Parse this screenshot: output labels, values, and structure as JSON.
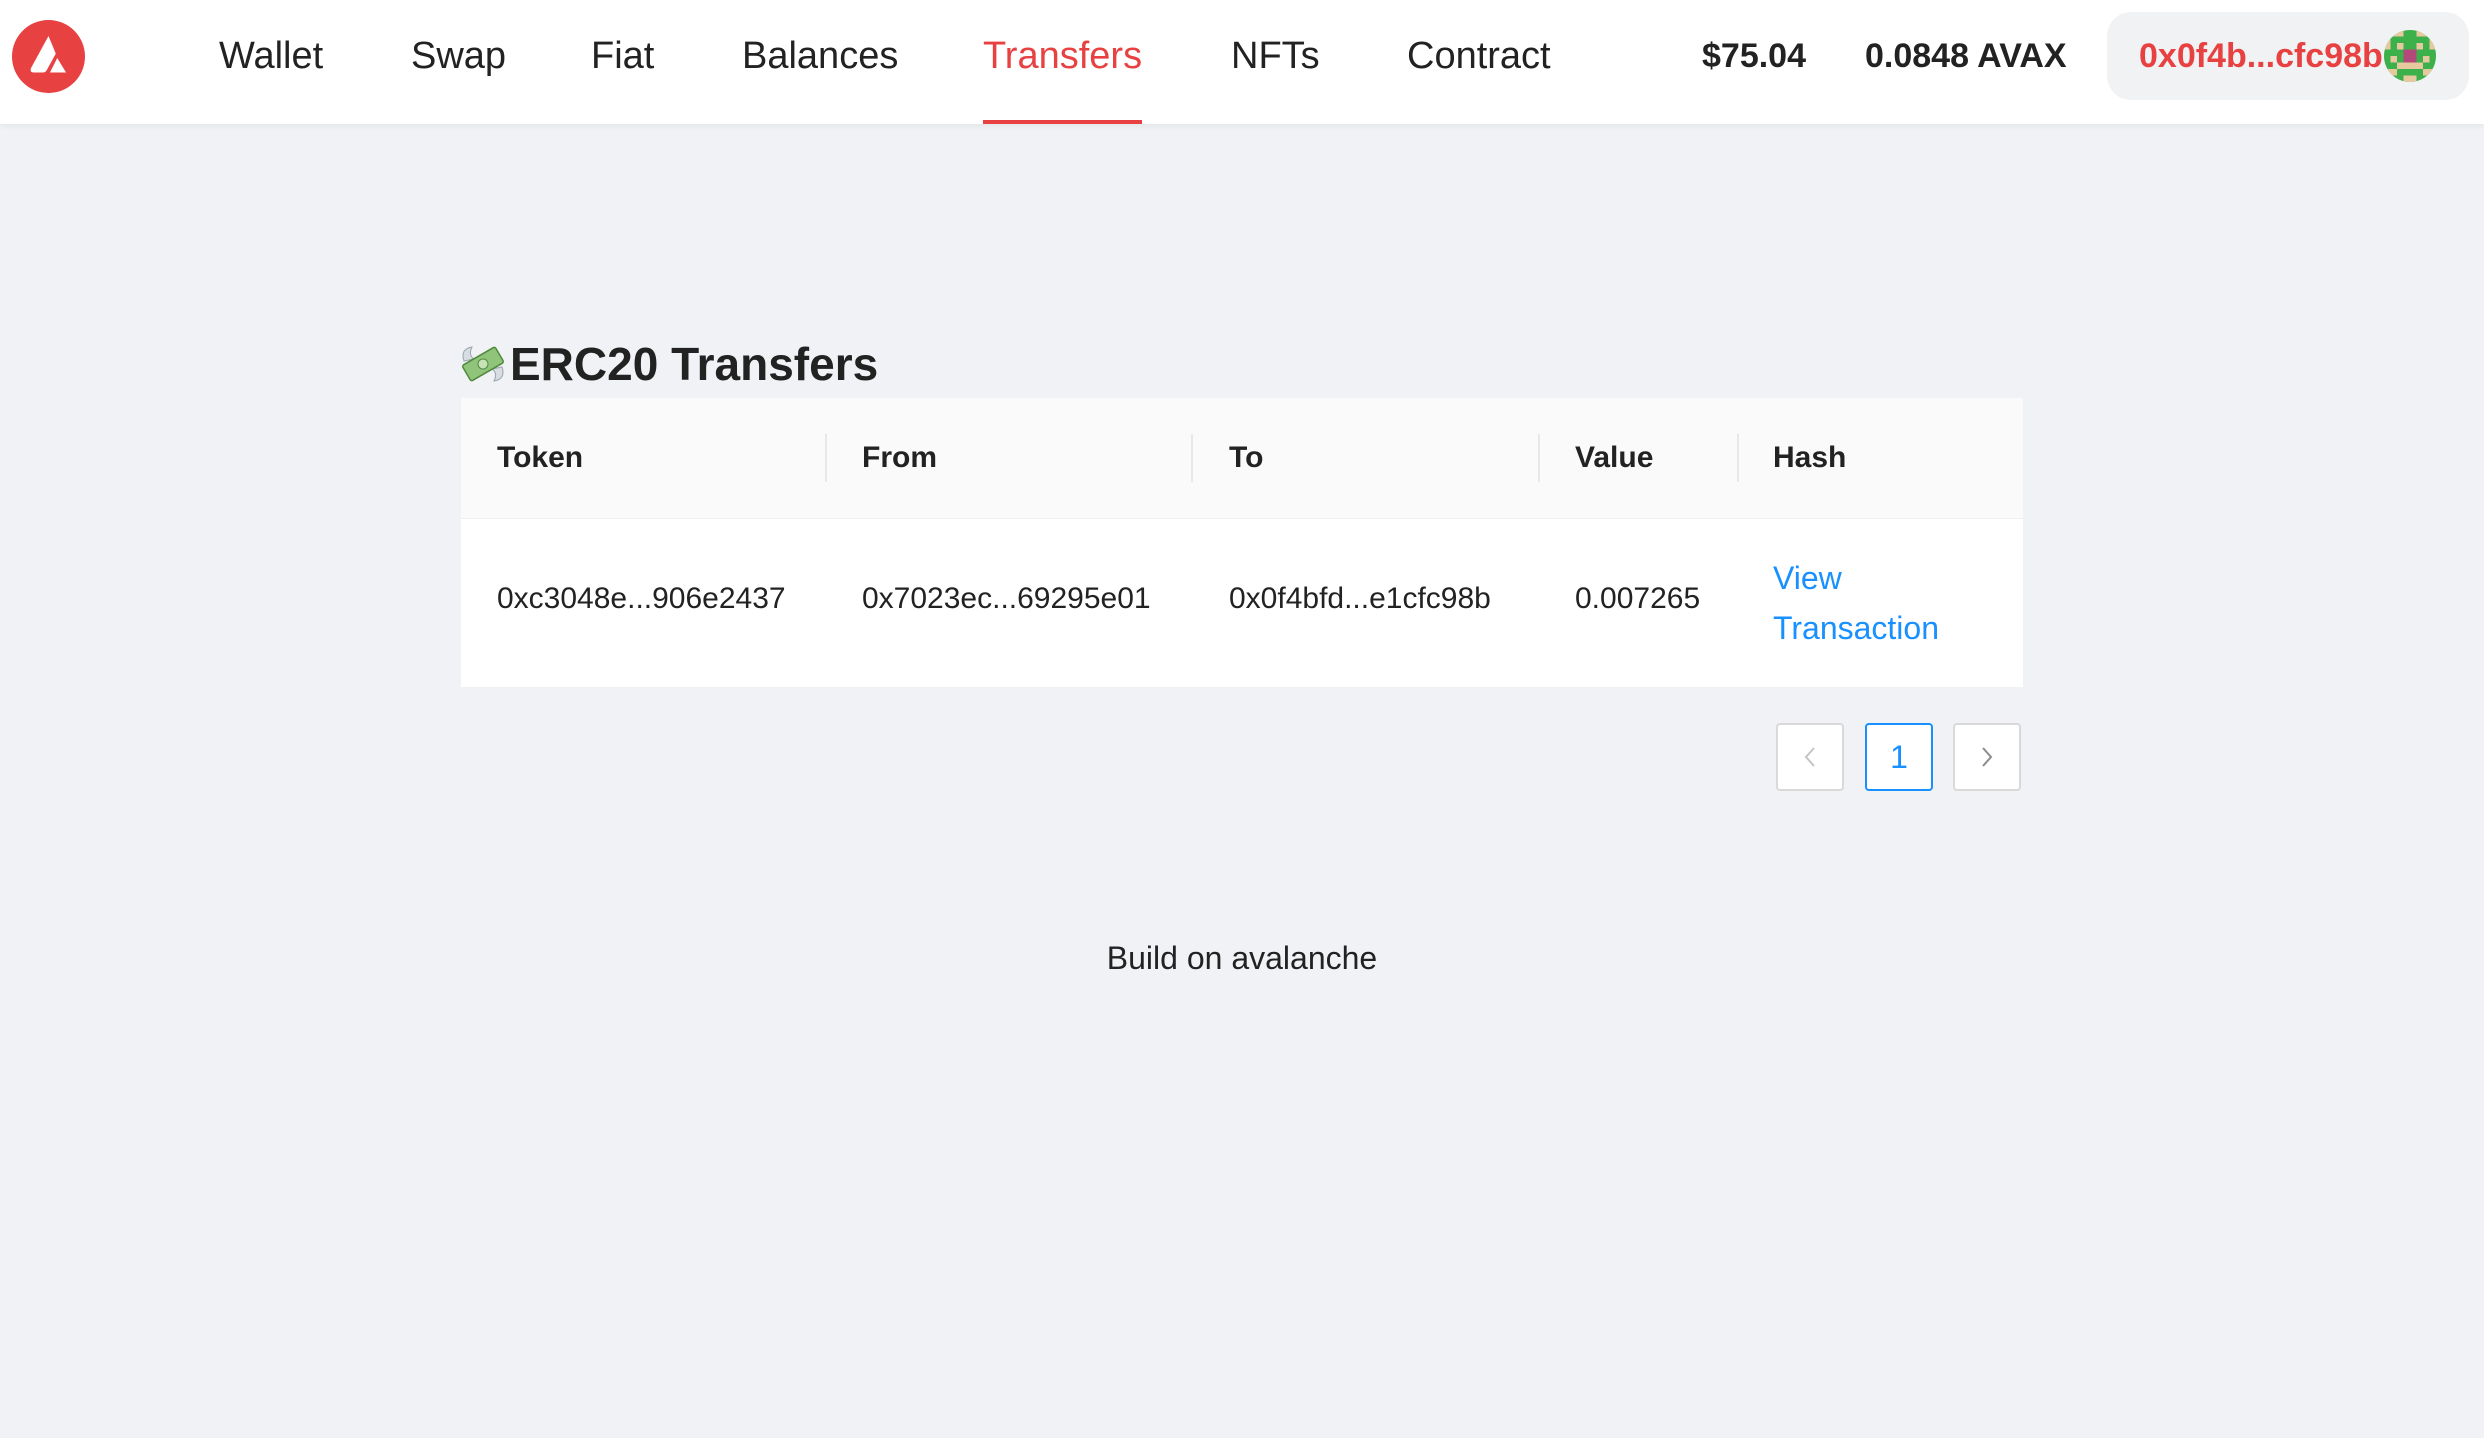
{
  "header": {
    "logo_icon": "avalanche-logo-icon",
    "nav": [
      {
        "label": "Wallet"
      },
      {
        "label": "Swap"
      },
      {
        "label": "Fiat"
      },
      {
        "label": "Balances"
      },
      {
        "label": "Transfers",
        "active": true
      },
      {
        "label": "NFTs"
      },
      {
        "label": "Contract"
      }
    ],
    "usd_balance": "$75.04",
    "avax_balance": "0.0848 AVAX",
    "account_address": "0x0f4b...cfc98b",
    "avatar_icon": "identicon-avatar"
  },
  "colors": {
    "accent": "#e84142",
    "link": "#1890ff",
    "background": "#f0f2f5"
  },
  "section": {
    "icon": "money-with-wings-icon",
    "title": "ERC20 Transfers"
  },
  "table": {
    "columns": [
      "Token",
      "From",
      "To",
      "Value",
      "Hash"
    ],
    "rows": [
      {
        "token": "0xc3048e...906e2437",
        "from": "0x7023ec...69295e01",
        "to": "0x0f4bfd...e1cfc98b",
        "value": "0.007265",
        "hash_link_line1": "View",
        "hash_link_line2": "Transaction"
      }
    ]
  },
  "pagination": {
    "prev_icon": "chevron-left-icon",
    "current_page": "1",
    "next_icon": "chevron-right-icon"
  },
  "footer": {
    "text": "Build on avalanche"
  }
}
